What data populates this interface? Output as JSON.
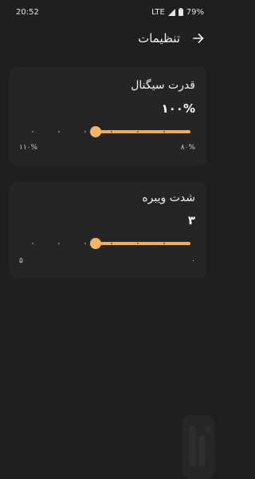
{
  "status": {
    "time": "20:52",
    "network": "LTE",
    "battery": "79%"
  },
  "header": {
    "title": "تنظیمات",
    "back_icon": "arrow-right-icon"
  },
  "cards": [
    {
      "title": "قدرت سیگنال",
      "value": "۱۰۰%",
      "slider_fraction": 0.6,
      "min_label": "۱۱۰%",
      "max_label": "۸۰%"
    },
    {
      "title": "شدت ویبره",
      "value": "۳",
      "slider_fraction": 0.6,
      "min_label": "۵",
      "max_label": "۰"
    }
  ],
  "colors": {
    "background": "#1f1f1f",
    "card": "#252525",
    "accent": "#f5b564"
  }
}
